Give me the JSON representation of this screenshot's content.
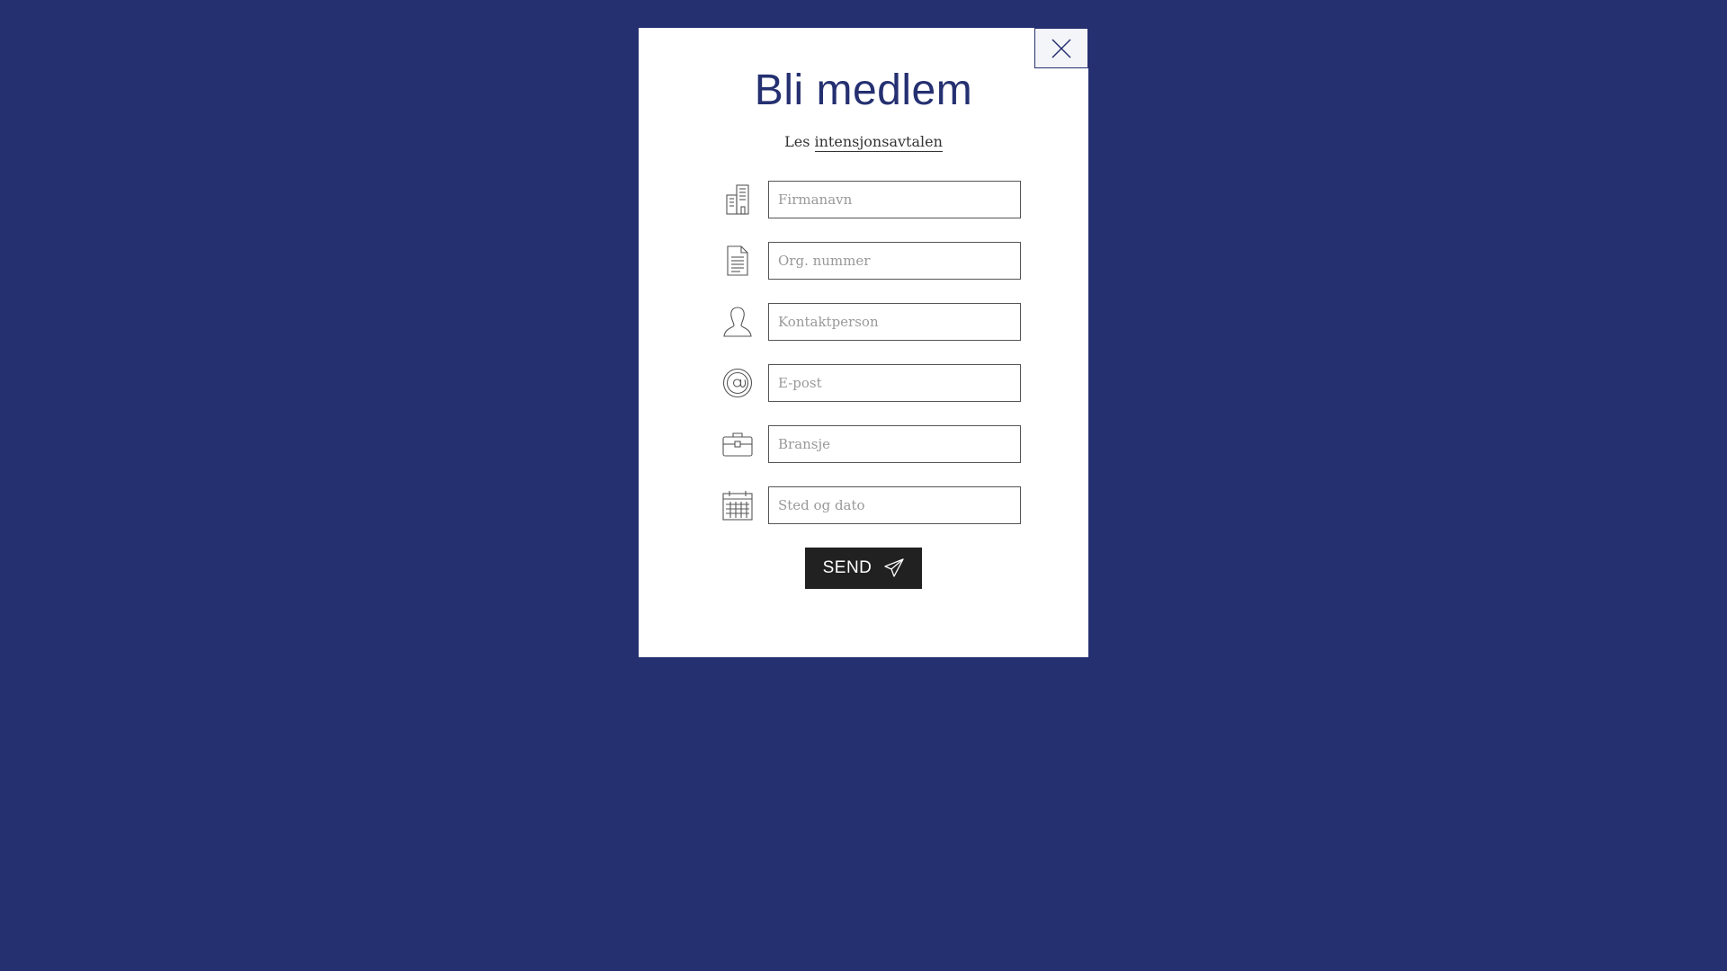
{
  "modal": {
    "title": "Bli medlem",
    "subtitle_prefix": "Les",
    "subtitle_link": "intensjonsavtalen",
    "close_icon": "close-icon"
  },
  "form": {
    "fields": [
      {
        "icon": "building-icon",
        "placeholder": "Firmanavn",
        "value": ""
      },
      {
        "icon": "document-icon",
        "placeholder": "Org. nummer",
        "value": ""
      },
      {
        "icon": "person-icon",
        "placeholder": "Kontaktperson",
        "value": ""
      },
      {
        "icon": "at-sign-icon",
        "placeholder": "E-post",
        "value": ""
      },
      {
        "icon": "briefcase-icon",
        "placeholder": "Bransje",
        "value": ""
      },
      {
        "icon": "calendar-icon",
        "placeholder": "Sted og dato",
        "value": ""
      }
    ],
    "submit_label": "SEND",
    "submit_icon": "paper-plane-icon"
  },
  "colors": {
    "background": "#253071",
    "modal": "#ffffff",
    "title": "#253071",
    "button": "#212121",
    "button_text": "#ffffff"
  }
}
